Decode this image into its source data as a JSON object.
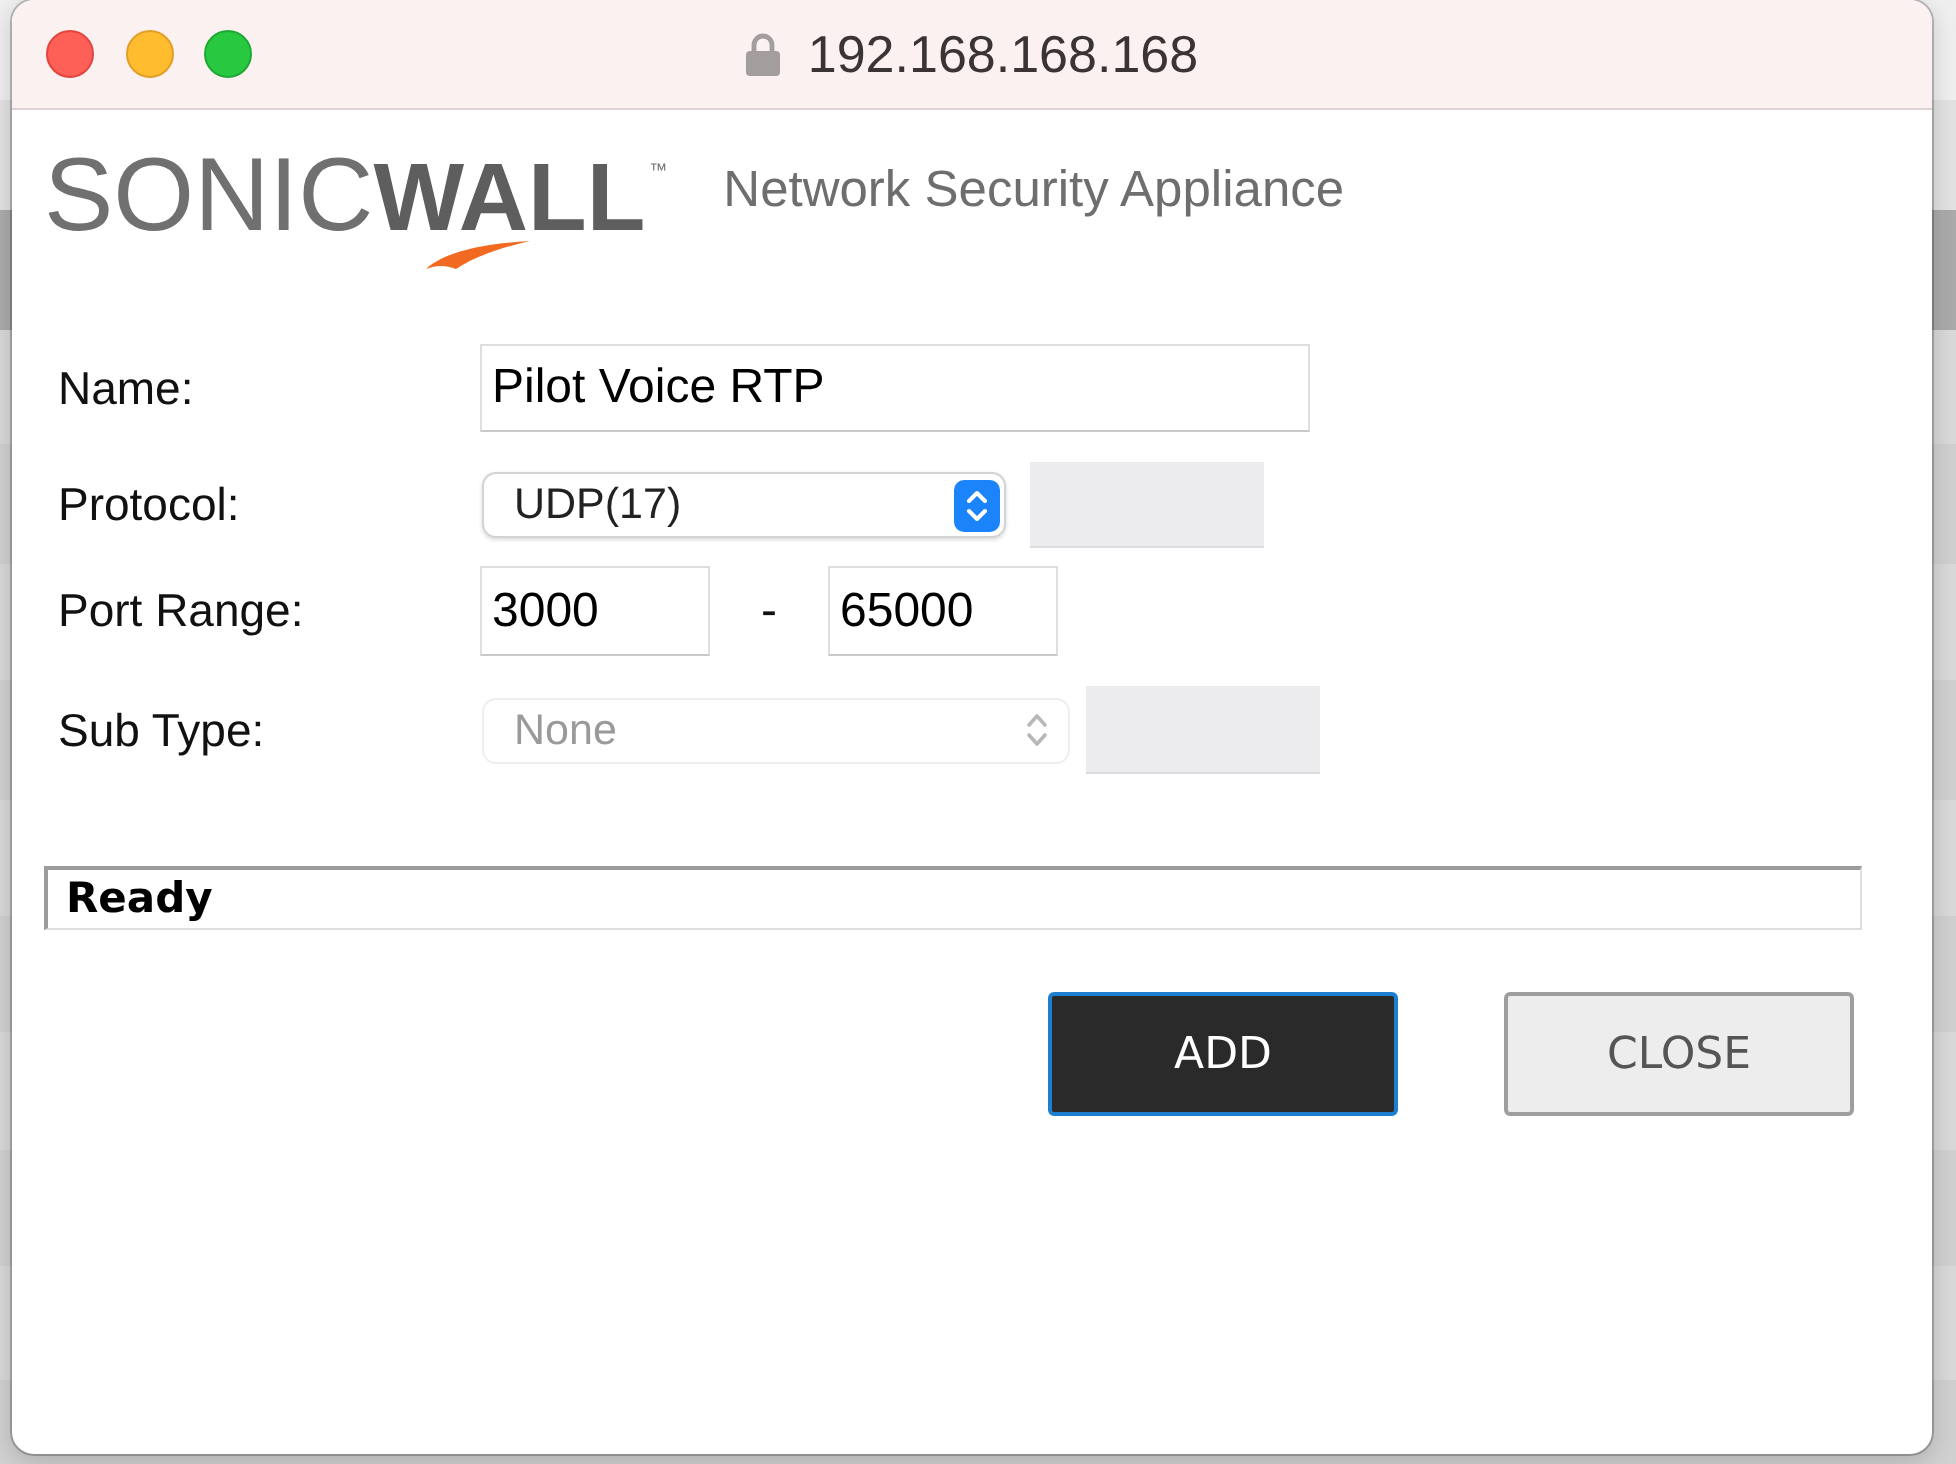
{
  "window": {
    "title": "192.168.168.168",
    "secure": true
  },
  "header": {
    "logo": "SONIC**WALL**$^{™}$",
    "subtitle": "Network Security Appliance"
  },
  "form": {
    "fields": [
      {
        "kind": "text",
        "label": "Name:",
        "value": "Pilot Voice RTP"
      },
      {
        "kind": "select",
        "label": "Protocol:",
        "value": "UDP(17)",
        "disabled": false,
        "side_field": {
          "disabled": true
        }
      },
      {
        "kind": "range",
        "label": "Port Range:",
        "from": "3000",
        "separator": "-",
        "to": "65000"
      },
      {
        "kind": "select",
        "label": "Sub Type:",
        "value": "None",
        "disabled": true,
        "side_field": {
          "disabled": true
        }
      }
    ]
  },
  "status_bar": {
    "text": "Ready"
  },
  "buttons": [
    {
      "label": "ADD",
      "primary": true
    },
    {
      "label": "CLOSE",
      "primary": false
    }
  ]
}
